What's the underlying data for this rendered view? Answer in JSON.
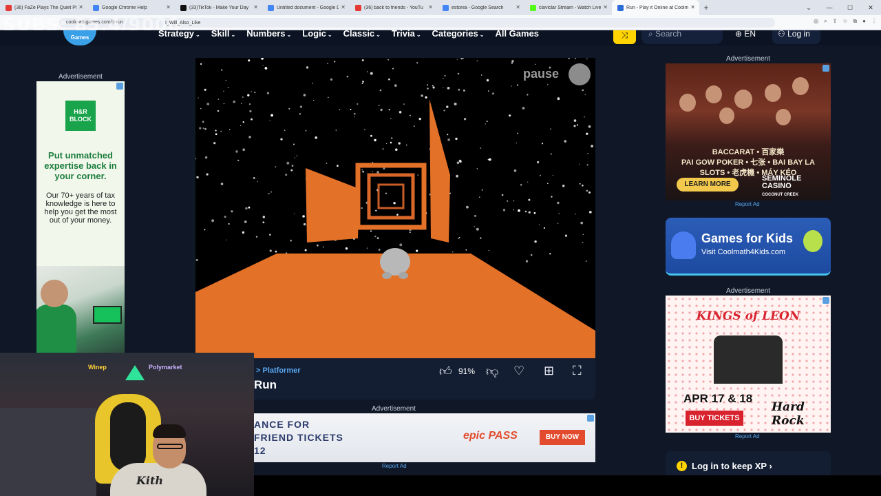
{
  "browser": {
    "tabs": [
      {
        "title": "(36) FaZe Plays The Quiet Place",
        "color": "#e53935",
        "active": false
      },
      {
        "title": "Google Chrome Help",
        "color": "#4285f4",
        "active": false
      },
      {
        "title": "(33)TikTok - Make Your Day",
        "color": "#111111",
        "active": false
      },
      {
        "title": "Untitled document - Google Do",
        "color": "#4285f4",
        "active": false
      },
      {
        "title": "(36) back to friends - YouTu",
        "color": "#e53935",
        "active": false
      },
      {
        "title": "estonia - Google Search",
        "color": "#4285f4",
        "active": false
      },
      {
        "title": "claviclar Stream - Watch Live",
        "color": "#53fc18",
        "active": false
      },
      {
        "title": "Run - Play it Online at Coolmath",
        "color": "#2b6cd8",
        "active": true
      }
    ],
    "new_tab": "+",
    "url": "coolmathgames.com/0-run",
    "overlay_text": "SUBS: 85,4/9000",
    "overlay_sub": "I_Will_Also_Like"
  },
  "site": {
    "logo_text": "Games",
    "nav": [
      "Strategy",
      "Skill",
      "Numbers",
      "Logic",
      "Classic",
      "Trivia",
      "Categories",
      "All Games"
    ],
    "search_placeholder": "Search",
    "language": "EN",
    "login": "Log in"
  },
  "left_ad": {
    "label": "Advertisement",
    "logo": "H&R BLOCK",
    "headline": "Put unmatched expertise back in your corner.",
    "body": "Our 70+ years of tax knowledge is here to help you get the most out of your money."
  },
  "game": {
    "pause": "pause",
    "breadcrumb": "> Platformer",
    "title": "Run",
    "like_pct": "91%"
  },
  "bottom_ad": {
    "label": "Advertisement",
    "lines": [
      "ANCE FOR",
      "FRIEND TICKETS",
      "12"
    ],
    "logo": "epic PASS",
    "button": "BUY NOW",
    "report": "Report Ad"
  },
  "webcam": {
    "sponsor1": "Winep",
    "sponsor2": "Polymarket",
    "hoodie_text": "Kith"
  },
  "right_ads": {
    "label1": "Advertisement",
    "casino_lines": [
      "BACCARAT • 百家樂",
      "PAI GOW POKER • 七张 • BAI BAY LA",
      "SLOTS • 老虎機 • MÁY KÉO"
    ],
    "casino_button": "LEARN MORE",
    "casino_logo": "SEMINOLE CASINO",
    "casino_logo_sub": "COCONUT CREEK",
    "report1": "Report Ad",
    "kids_title": "Games for Kids",
    "kids_sub": "Visit Coolmath4Kids.com",
    "label2": "Advertisement",
    "kings_title": "KINGS of LEON",
    "kings_date": "APR 17 & 18",
    "kings_button": "BUY TICKETS",
    "kings_logo": "Hard Rock",
    "report2": "Report Ad",
    "xp_text": "Log in to keep XP"
  }
}
